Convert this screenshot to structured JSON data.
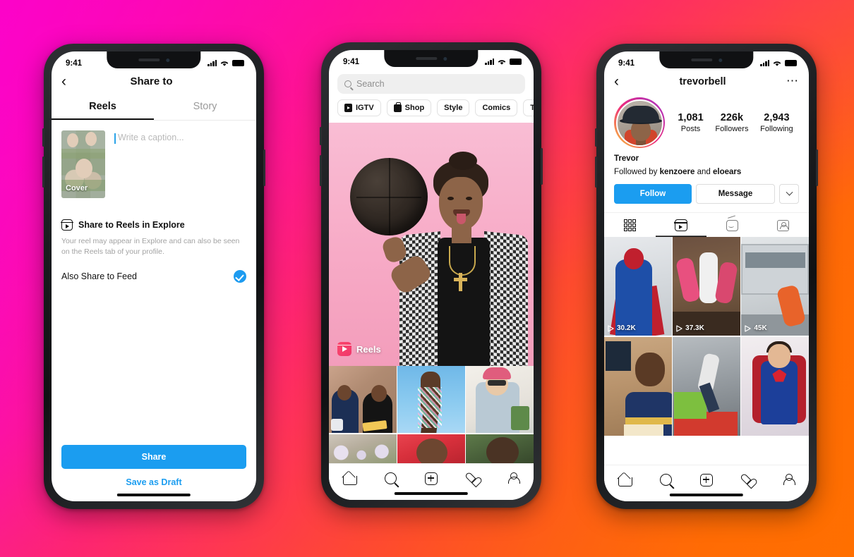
{
  "background": {
    "from": "#f806d6",
    "mid": "#fe4436",
    "to": "#ff7000"
  },
  "status_bar": {
    "time": "9:41"
  },
  "phone1": {
    "nav": {
      "back_icon": "chevron-left-icon",
      "title": "Share to"
    },
    "tabs": [
      {
        "label": "Reels",
        "active": true
      },
      {
        "label": "Story",
        "active": false
      }
    ],
    "composer": {
      "cover_label": "Cover",
      "caption_placeholder": "Write a caption...",
      "caption_value": ""
    },
    "explore_section": {
      "icon": "reels-icon",
      "heading": "Share to Reels in Explore",
      "description": "Your reel may appear in Explore and can also be seen on the Reels tab of your profile."
    },
    "feed_option": {
      "label": "Also Share to Feed",
      "checked": true
    },
    "actions": {
      "share_label": "Share",
      "draft_label": "Save as Draft"
    }
  },
  "phone2": {
    "search": {
      "placeholder": "Search",
      "value": "",
      "icon": "search-icon"
    },
    "chips": [
      {
        "label": "IGTV",
        "icon": "igtv-icon"
      },
      {
        "label": "Shop",
        "icon": "shopping-bag-icon"
      },
      {
        "label": "Style",
        "icon": ""
      },
      {
        "label": "Comics",
        "icon": ""
      },
      {
        "label": "TV & Movie",
        "icon": ""
      }
    ],
    "hero": {
      "badge_label": "Reels",
      "badge_icon": "reels-icon",
      "accent": "#fa4a6e"
    },
    "tabbar": [
      {
        "name": "home",
        "icon": "home-icon"
      },
      {
        "name": "search",
        "icon": "search-icon"
      },
      {
        "name": "create",
        "icon": "plus-box-icon"
      },
      {
        "name": "activity",
        "icon": "heart-icon"
      },
      {
        "name": "profile",
        "icon": "person-icon"
      }
    ]
  },
  "phone3": {
    "nav": {
      "back_icon": "chevron-left-icon",
      "username": "trevorbell",
      "more_icon": "more-options-icon"
    },
    "stats": [
      {
        "number": "1,081",
        "label": "Posts"
      },
      {
        "number": "226k",
        "label": "Followers"
      },
      {
        "number": "2,943",
        "label": "Following"
      }
    ],
    "bio": {
      "display_name": "Trevor",
      "followed_by_prefix": "Followed by ",
      "followed_by_1": "kenzoere",
      "followed_by_join": " and ",
      "followed_by_2": "eloears"
    },
    "actions": {
      "follow_label": "Follow",
      "message_label": "Message",
      "chevron_icon": "chevron-down-icon",
      "follow_color": "#1b9df0"
    },
    "profile_tabs": [
      {
        "name": "grid",
        "icon": "grid-icon",
        "active": false
      },
      {
        "name": "reels",
        "icon": "reels-icon",
        "active": true
      },
      {
        "name": "igtv",
        "icon": "igtv-icon",
        "active": false
      },
      {
        "name": "tagged",
        "icon": "tagged-icon",
        "active": false
      }
    ],
    "videos": [
      {
        "views": "30.2K"
      },
      {
        "views": "37.3K"
      },
      {
        "views": "45K"
      },
      {
        "views": ""
      },
      {
        "views": ""
      },
      {
        "views": ""
      }
    ]
  }
}
